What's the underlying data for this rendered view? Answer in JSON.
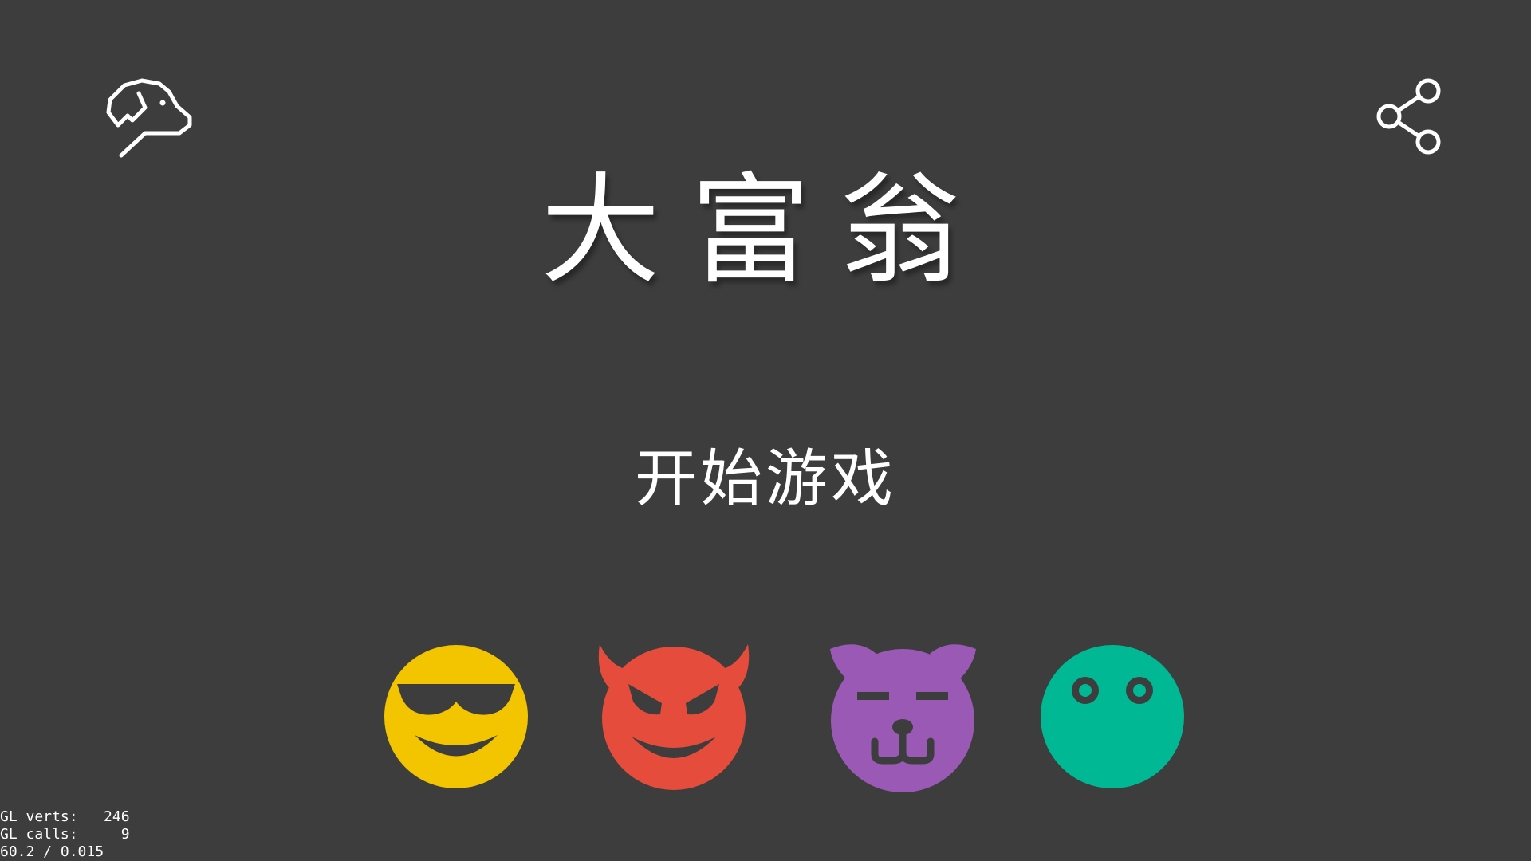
{
  "title": "大富翁",
  "start_button_label": "开始游戏",
  "colors": {
    "background": "#3d3d3d",
    "player_cool": "#f2c500",
    "player_devil": "#e64c3c",
    "player_bear": "#9b59b6",
    "player_frog": "#00b894"
  },
  "icons": {
    "top_left": "dog-icon",
    "top_right": "share-icon"
  },
  "players": [
    {
      "icon": "sunglasses-face-icon"
    },
    {
      "icon": "devil-face-icon"
    },
    {
      "icon": "bear-face-icon"
    },
    {
      "icon": "frog-face-icon"
    }
  ],
  "debug_stats": {
    "verts_line": "GL verts:   246",
    "calls_line": "GL calls:     9",
    "fps_line": "60.2 / 0.015"
  }
}
